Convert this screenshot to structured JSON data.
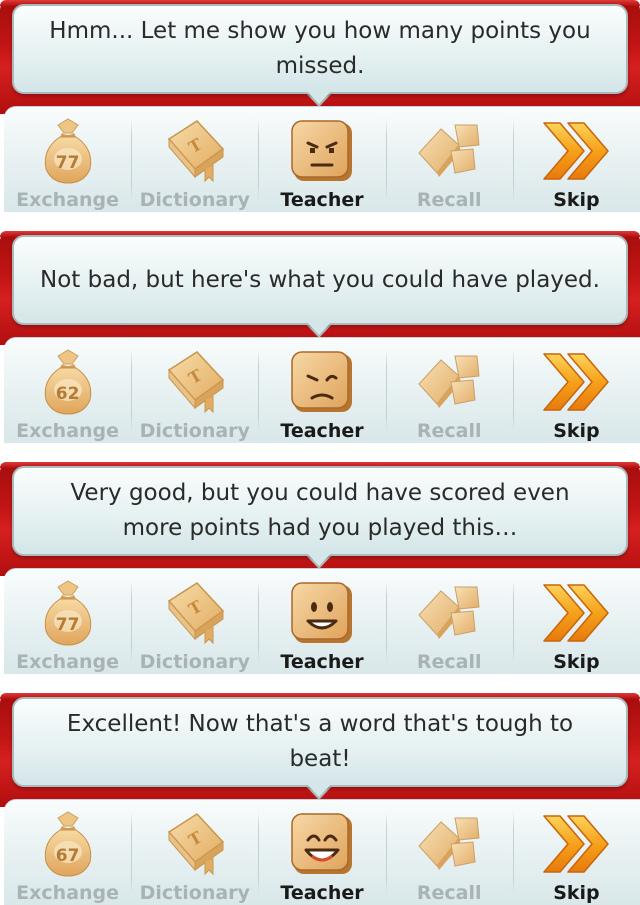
{
  "labels": {
    "exchange": "Exchange",
    "dictionary": "Dictionary",
    "teacher": "Teacher",
    "recall": "Recall",
    "skip": "Skip"
  },
  "panels": [
    {
      "message": "Hmm... Let me show you how many points you missed.",
      "exchange_count": "77",
      "teacher_face": "frowning"
    },
    {
      "message": "Not bad, but here's what you could have played.",
      "exchange_count": "62",
      "teacher_face": "grimacing"
    },
    {
      "message": "Very good, but you could have scored even more points had you played this…",
      "exchange_count": "77",
      "teacher_face": "smiling"
    },
    {
      "message": "Excellent! Now that's a word that's tough to beat!",
      "exchange_count": "67",
      "teacher_face": "laughing"
    }
  ],
  "icons": {
    "exchange": "tile-bag-icon",
    "dictionary": "dictionary-book-icon",
    "teacher": "teacher-tile-face-icon",
    "recall": "recall-tiles-icon",
    "skip": "skip-double-chevron-icon"
  },
  "colors": {
    "frame_red": "#c21515",
    "bubble": "#e6f1f2",
    "disabled_label": "#a9b3b5",
    "enabled_label": "#1a1a1a",
    "skip_orange": "#f39a12",
    "tile_tan": "#e9b874"
  }
}
